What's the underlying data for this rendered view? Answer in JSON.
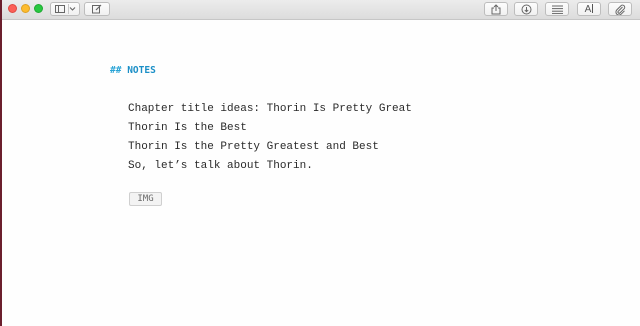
{
  "toolbar": {
    "window_controls": [
      "close",
      "minimize",
      "zoom"
    ],
    "left_buttons": [
      {
        "name": "sidebar-toggle",
        "icon": "sidebar-icon",
        "dropdown_icon": "chevron-down-icon"
      },
      {
        "name": "compose",
        "icon": "compose-icon"
      }
    ],
    "right_buttons": [
      {
        "name": "share",
        "icon": "share-icon"
      },
      {
        "name": "sync",
        "icon": "sync-icon"
      },
      {
        "name": "list",
        "icon": "list-icon"
      },
      {
        "name": "font",
        "icon": "font-icon",
        "glyph": "A"
      },
      {
        "name": "attach",
        "icon": "paperclip-icon"
      }
    ]
  },
  "editor": {
    "heading_marker": "##",
    "heading_text": "NOTES",
    "lines": [
      "Chapter title ideas: Thorin Is Pretty Great",
      "Thorin Is the Best",
      "Thorin Is the Pretty Greatest and Best",
      "So, let’s talk about Thorin."
    ],
    "image_placeholder": "IMG"
  },
  "colors": {
    "heading": "#1b8fc7",
    "text": "#2a2a2a",
    "close": "#fc5f57",
    "minimize": "#fdbc2e",
    "zoom": "#28c840"
  }
}
